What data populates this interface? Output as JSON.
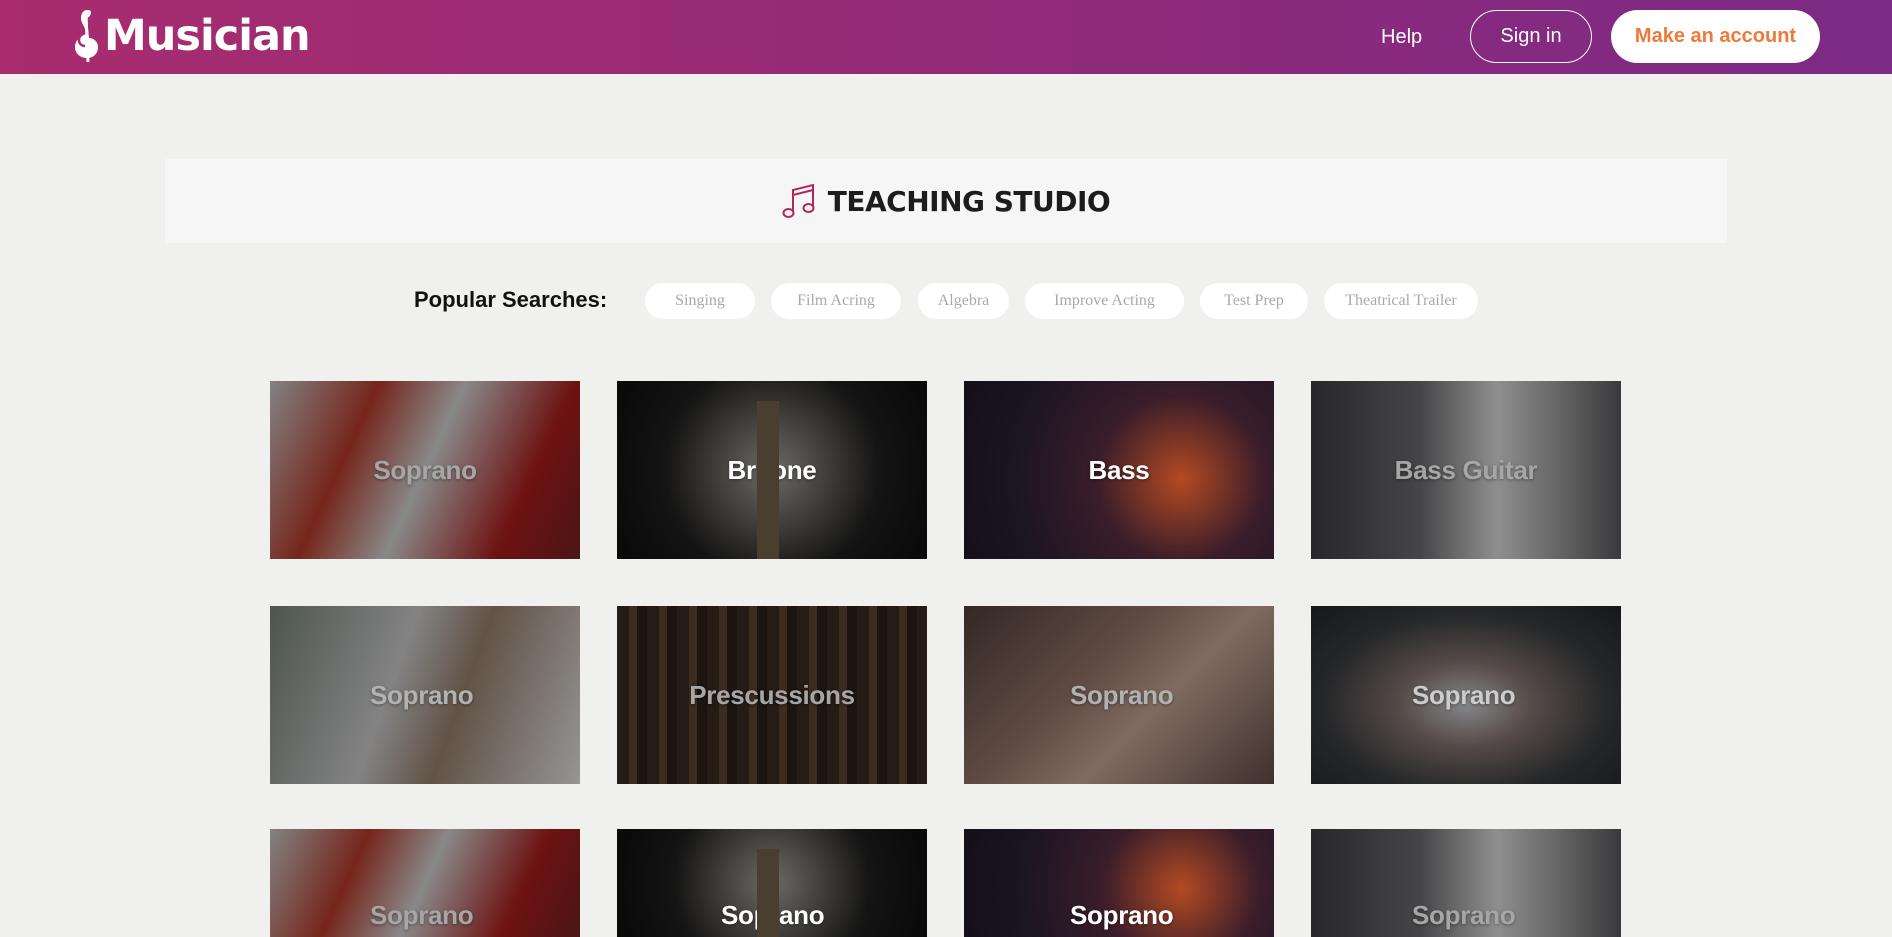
{
  "header": {
    "logo_text": "Musician",
    "help_label": "Help",
    "signin_label": "Sign in",
    "account_label": "Make an account",
    "colors": {
      "gradient_start": "#a82c6e",
      "gradient_end": "#7b2a86",
      "account_text": "#ee7a3a"
    }
  },
  "studio": {
    "icon": "music-note-icon",
    "title": "TEACHING STUDIO",
    "icon_color": "#b0285c"
  },
  "popular": {
    "label": "Popular Searches:",
    "chips": [
      "Singing",
      "Film Acring",
      "Algebra",
      "Improve Acting",
      "Test Prep",
      "Theatrical Trailer"
    ]
  },
  "tiles": [
    {
      "label": "Soprano"
    },
    {
      "label": "Britone"
    },
    {
      "label": "Bass"
    },
    {
      "label": "Bass Guitar"
    },
    {
      "label": "Soprano"
    },
    {
      "label": "Prescussions"
    },
    {
      "label": "Soprano"
    },
    {
      "label": "Soprano"
    },
    {
      "label": "Soprano"
    },
    {
      "label": "Soprano"
    },
    {
      "label": "Soprano"
    },
    {
      "label": "Soprano"
    }
  ]
}
